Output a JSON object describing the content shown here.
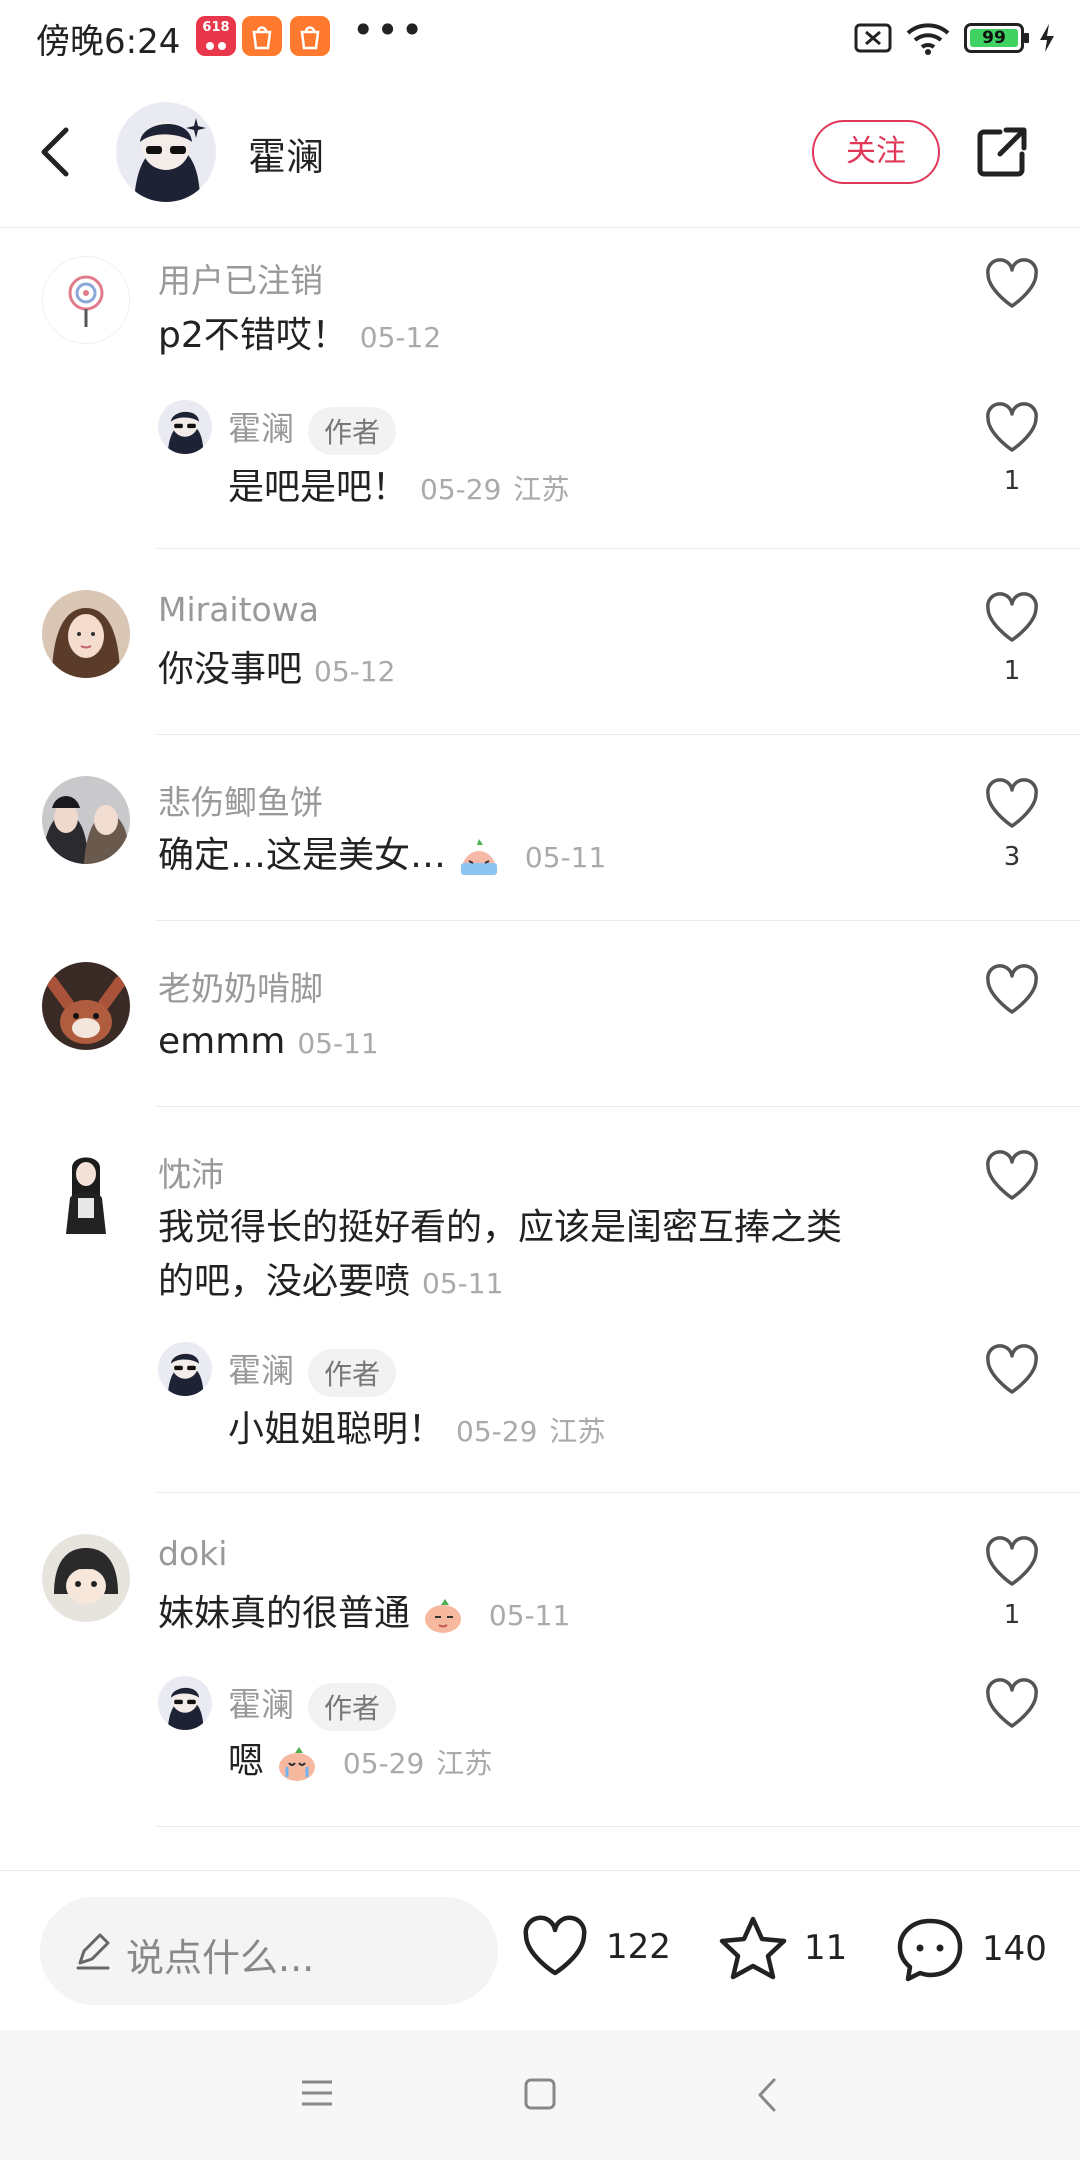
{
  "status_bar": {
    "time": "傍晚6:24",
    "app_badge": "618",
    "battery": "99"
  },
  "header": {
    "author_name": "霍澜",
    "follow_label": "关注"
  },
  "comments": [
    {
      "user": "用户已注销",
      "text": "p2不错哎！",
      "time": "05-12",
      "likes": "",
      "reply": {
        "user": "霍澜",
        "tag": "作者",
        "text": "是吧是吧！",
        "time": "05-29",
        "location": "江苏",
        "likes": "1"
      }
    },
    {
      "user": "Miraitowa",
      "text": "你没事吧",
      "time": "05-12",
      "likes": "1"
    },
    {
      "user": "悲伤鲫鱼饼",
      "text": "确定…这是美女…",
      "time": "05-11",
      "likes": "3"
    },
    {
      "user": "老奶奶啃脚",
      "text": "emmm",
      "time": "05-11",
      "likes": ""
    },
    {
      "user": "忱沛",
      "text_line1": "我觉得长的挺好看的，应该是闺密互捧之类",
      "text_line2": "的吧，没必要喷",
      "time": "05-11",
      "likes": "",
      "reply": {
        "user": "霍澜",
        "tag": "作者",
        "text": "小姐姐聪明！",
        "time": "05-29",
        "location": "江苏",
        "likes": ""
      }
    },
    {
      "user": "doki",
      "text": "妹妹真的很普通",
      "time": "05-11",
      "likes": "1",
      "reply": {
        "user": "霍澜",
        "tag": "作者",
        "text": "嗯",
        "time": "05-29",
        "location": "江苏",
        "likes": ""
      }
    }
  ],
  "bottom_bar": {
    "input_placeholder": "说点什么...",
    "like_count": "122",
    "collect_count": "11",
    "comment_count": "140"
  },
  "colors": {
    "accent": "#e0385a",
    "muted_text": "#999999",
    "divider": "#ececec"
  }
}
